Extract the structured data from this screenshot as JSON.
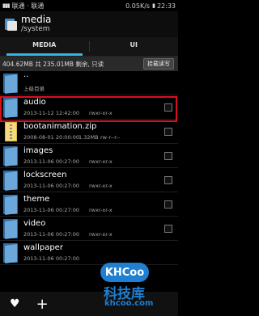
{
  "status_bar": {
    "carrier": "联通 · 联通",
    "speed": "0.05K/s",
    "time": "22:33"
  },
  "title_bar": {
    "title": "media",
    "path": "/system"
  },
  "tabs": [
    {
      "label": "MEDIA",
      "active": true
    },
    {
      "label": "UI",
      "active": false
    }
  ],
  "info_bar": {
    "storage": "404.62MB 共 235.01MB 剩余, 只读",
    "mount_button": "挂载读写"
  },
  "files": [
    {
      "name": "..",
      "meta": "上级目录",
      "type": "folder",
      "icon": "folder-icon"
    },
    {
      "name": "audio",
      "date": "2013-11-12 12:42:00",
      "perm": "rwxr-xr-x",
      "type": "folder",
      "icon": "folder-icon"
    },
    {
      "name": "bootanimation.zip",
      "date": "2008-08-01 20:00:00",
      "size": "1.32MB",
      "perm": "rw-r--r--",
      "type": "zip",
      "icon": "zip-file-icon"
    },
    {
      "name": "images",
      "date": "2013-11-06 00:27:00",
      "perm": "rwxr-xr-x",
      "type": "folder",
      "icon": "folder-icon"
    },
    {
      "name": "lockscreen",
      "date": "2013-11-06 00:27:00",
      "perm": "rwxr-xr-x",
      "type": "folder",
      "icon": "folder-icon"
    },
    {
      "name": "theme",
      "date": "2013-11-06 00:27:00",
      "perm": "rwxr-xr-x",
      "type": "folder",
      "icon": "folder-icon"
    },
    {
      "name": "video",
      "date": "2013-11-06 00:27:00",
      "perm": "rwxr-xr-x",
      "type": "folder",
      "icon": "folder-icon"
    },
    {
      "name": "wallpaper",
      "date": "2013-11-06 00:27:00",
      "perm": "",
      "type": "folder",
      "icon": "folder-icon"
    }
  ],
  "bottom_bar": {
    "favorite_icon": "heart-icon",
    "add_icon": "plus-icon"
  },
  "watermark": {
    "logo": "KHCoo",
    "name": "科技库",
    "url": "khcoo.com"
  },
  "colors": {
    "accent": "#33b5e5",
    "highlight": "#d8111e",
    "folder": "#6ba7d8",
    "watermark": "#1f7fd0"
  }
}
